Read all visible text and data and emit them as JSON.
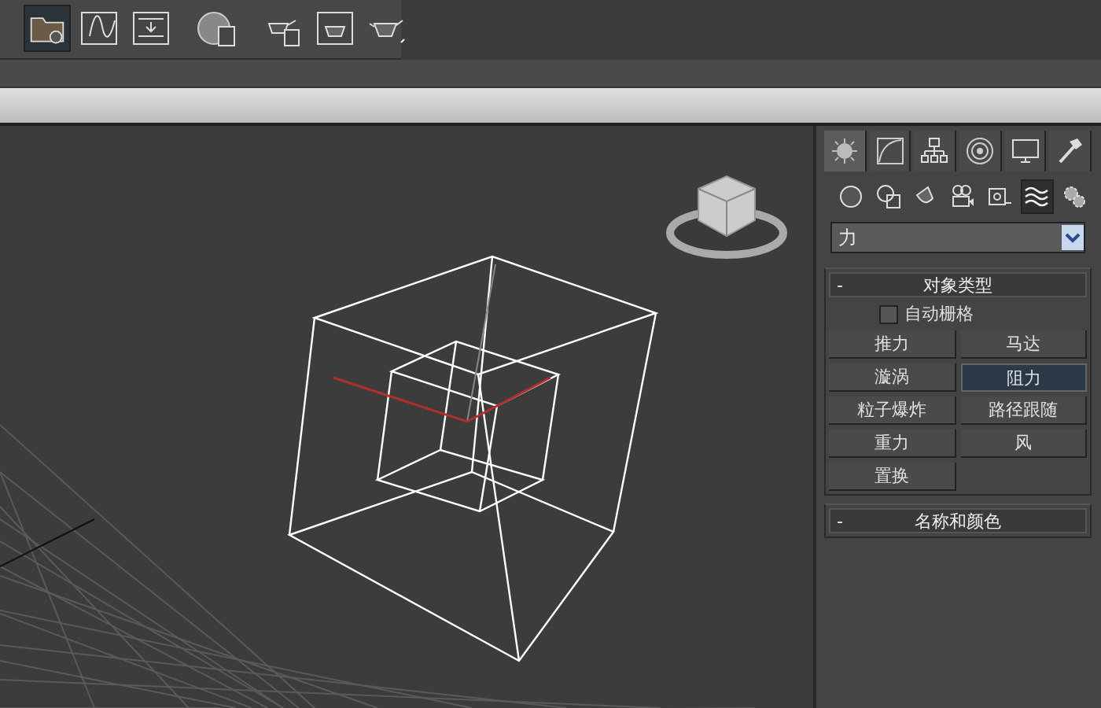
{
  "command_tabs": [
    {
      "kind": "create",
      "selected": true
    },
    {
      "kind": "modify",
      "selected": false
    },
    {
      "kind": "hierarchy",
      "selected": false
    },
    {
      "kind": "motion",
      "selected": false
    },
    {
      "kind": "display",
      "selected": false
    },
    {
      "kind": "utilities",
      "selected": false
    }
  ],
  "categories": [
    {
      "kind": "geometry",
      "selected": false
    },
    {
      "kind": "shapes",
      "selected": false
    },
    {
      "kind": "lights",
      "selected": false
    },
    {
      "kind": "cameras",
      "selected": false
    },
    {
      "kind": "helpers",
      "selected": false
    },
    {
      "kind": "spacewarps",
      "selected": true
    },
    {
      "kind": "systems",
      "selected": false
    }
  ],
  "dropdown": {
    "value": "力"
  },
  "object_type": {
    "toggle": "-",
    "title": "对象类型",
    "autogrid": {
      "label": "自动栅格",
      "checked": false
    },
    "buttons": [
      {
        "label": "推力",
        "selected": false
      },
      {
        "label": "马达",
        "selected": false
      },
      {
        "label": "漩涡",
        "selected": false
      },
      {
        "label": "阻力",
        "selected": true
      },
      {
        "label": "粒子爆炸",
        "selected": false
      },
      {
        "label": "路径跟随",
        "selected": false
      },
      {
        "label": "重力",
        "selected": false
      },
      {
        "label": "风",
        "selected": false
      },
      {
        "label": "置换",
        "selected": false
      }
    ]
  },
  "name_and_color": {
    "toggle": "-",
    "title": "名称和颜色"
  }
}
